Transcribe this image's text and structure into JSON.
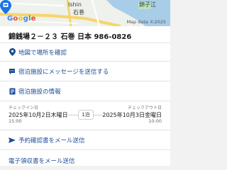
{
  "map": {
    "logo": "Google",
    "place_label_1": "Ishin",
    "place_label_2": "石巻",
    "place_label_3": "錦子江",
    "copyright": "Map data ©2025",
    "colors": {
      "land": "#eef1ec",
      "road": "#f6d56a",
      "water": "#a8cde8",
      "pin": "#1a73e8"
    }
  },
  "address": "錦銭場２－２３ 石巻 日本 986-0826",
  "actions": [
    {
      "icon": "location-pin-icon",
      "label": "地図で場所を確認"
    },
    {
      "icon": "chat-bubble-icon",
      "label": "宿泊施設にメッセージを送信する"
    },
    {
      "icon": "document-icon",
      "label": "宿泊施設の情報"
    }
  ],
  "stay": {
    "checkin_caption": "チェックイン日",
    "checkin_date": "2025年10月2日木曜日",
    "checkin_time": "15:00",
    "nights": "1泊",
    "checkout_caption": "チェックアウト日",
    "checkout_date": "2025年10月3日金曜日",
    "checkout_time": "10:00"
  },
  "bottom_actions": [
    {
      "icon": "send-icon",
      "label": "予約確認書をメール送信"
    },
    {
      "label": "電子領収書をメール送信"
    }
  ],
  "accent_color": "#1b4d98"
}
